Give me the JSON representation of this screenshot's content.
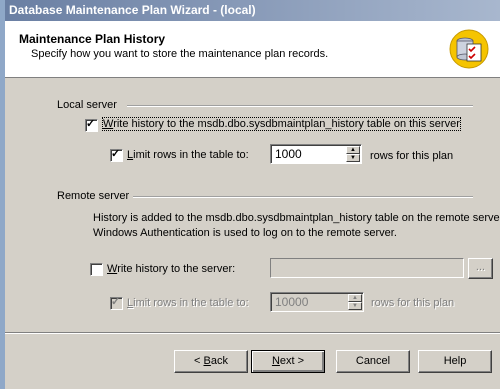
{
  "window": {
    "title": "Database Maintenance Plan Wizard - (local)"
  },
  "header": {
    "title": "Maintenance Plan History",
    "subtitle": "Specify how you want to store the maintenance plan records."
  },
  "local_server": {
    "group_label": "Local server",
    "write_history_label": "Write history to the msdb.dbo.sysdbmaintplan_history table on this server",
    "write_history_checked": true,
    "limit_rows_label": "Limit rows in the table to:",
    "limit_rows_checked": true,
    "limit_rows_value": "1000",
    "rows_suffix": "rows for this plan"
  },
  "remote_server": {
    "group_label": "Remote server",
    "info_line1": "History is added to the msdb.dbo.sysdbmaintplan_history table on the remote server.",
    "info_line2": "Windows Authentication is used to log on to the remote server.",
    "write_history_label": "Write history to the server:",
    "write_history_checked": false,
    "server_value": "",
    "browse_label": "...",
    "limit_rows_label": "Limit rows in the table to:",
    "limit_rows_checked": true,
    "limit_rows_value": "10000",
    "rows_suffix": "rows for this plan"
  },
  "buttons": {
    "back": "< Back",
    "next": "Next >",
    "cancel": "Cancel",
    "help": "Help"
  },
  "icons": {
    "header_logo": "database-checklist-icon",
    "check": "✓"
  }
}
